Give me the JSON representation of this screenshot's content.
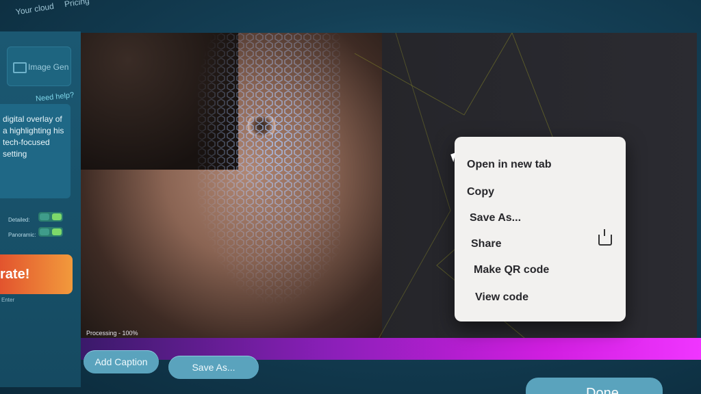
{
  "top_nav": {
    "items": [
      "Your cloud",
      "Pricing"
    ]
  },
  "sidebar": {
    "image_gen_label": "Image Gen",
    "need_help": "Need help?",
    "prompt_text": "digital overlay of a highlighting his tech-focused setting",
    "options": [
      {
        "label": "Detailed:"
      },
      {
        "label": "Panoramic:"
      }
    ],
    "generate_label": "rate!",
    "enter_hint": "Enter"
  },
  "canvas": {
    "status": "Processing - 100%",
    "progress": 1.0
  },
  "context_menu": {
    "items": [
      "Open in new tab",
      "Copy",
      "Save As...",
      "Share",
      "Make QR code",
      "View code"
    ]
  },
  "bottom": {
    "add_caption": "Add Caption",
    "save_as": "Save As...",
    "done": "Done"
  },
  "colors": {
    "progress_start": "#3a1a6a",
    "progress_end": "#f035ff",
    "generate": "#e2542e",
    "button": "#5aa3bd"
  }
}
